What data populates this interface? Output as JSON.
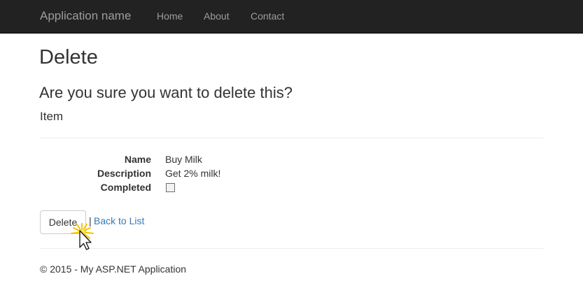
{
  "navbar": {
    "brand": "Application name",
    "links": [
      "Home",
      "About",
      "Contact"
    ],
    "background": "#222222",
    "link_color": "#9d9d9d"
  },
  "page": {
    "title": "Delete",
    "question": "Are you sure you want to delete this?",
    "entity": "Item"
  },
  "details": [
    {
      "label": "Name",
      "value": "Buy Milk"
    },
    {
      "label": "Description",
      "value": "Get 2% milk!"
    },
    {
      "label": "Completed",
      "checked": false
    }
  ],
  "actions": {
    "delete_label": "Delete",
    "separator": "|",
    "back_label": "Back to List",
    "link_color": "#337ab7"
  },
  "footer": {
    "text": "© 2015 - My ASP.NET Application"
  },
  "cursor": {
    "icon": "pointer-arrow-icon",
    "highlight": "click-burst-icon",
    "highlight_color": "#f5c400"
  }
}
